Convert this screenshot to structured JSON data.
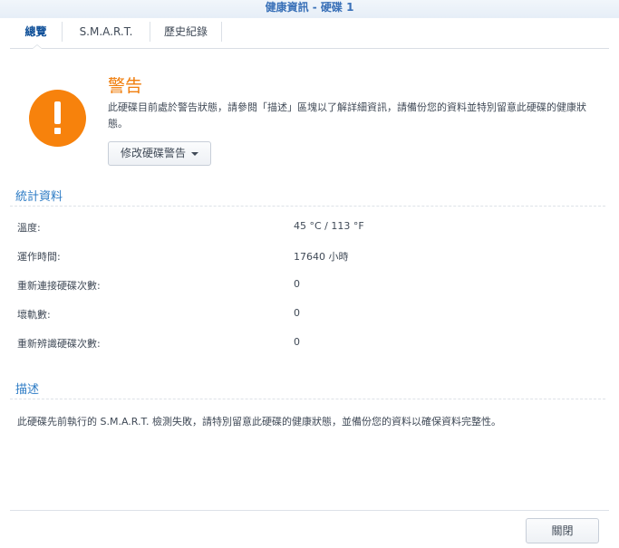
{
  "window": {
    "title": "健康資訊 - 硬碟 1"
  },
  "tabs": [
    {
      "label": "總覽",
      "active": true
    },
    {
      "label": "S.M.A.R.T.",
      "active": false
    },
    {
      "label": "歷史紀錄",
      "active": false
    }
  ],
  "warning": {
    "title": "警告",
    "message": "此硬碟目前處於警告狀態，請參閱「描述」區塊以了解詳細資訊，請備份您的資料並特別留意此硬碟的健康狀態。",
    "modify_button_label": "修改硬碟警告",
    "icon": "exclamation-circle-icon",
    "color": "#f7820c"
  },
  "stats": {
    "title": "統計資料",
    "rows": [
      {
        "label": "溫度:",
        "value": "45 °C / 113 °F"
      },
      {
        "label": "運作時間:",
        "value": "17640 小時"
      },
      {
        "label": "重新連接硬碟次數:",
        "value": "0"
      },
      {
        "label": "壞軌數:",
        "value": "0"
      },
      {
        "label": "重新辨識硬碟次數:",
        "value": "0"
      }
    ]
  },
  "description": {
    "title": "描述",
    "text": "此硬碟先前執行的 S.M.A.R.T. 檢測失敗，請特別留意此硬碟的健康狀態，並備份您的資料以確保資料完整性。"
  },
  "footer": {
    "close_label": "關閉"
  }
}
